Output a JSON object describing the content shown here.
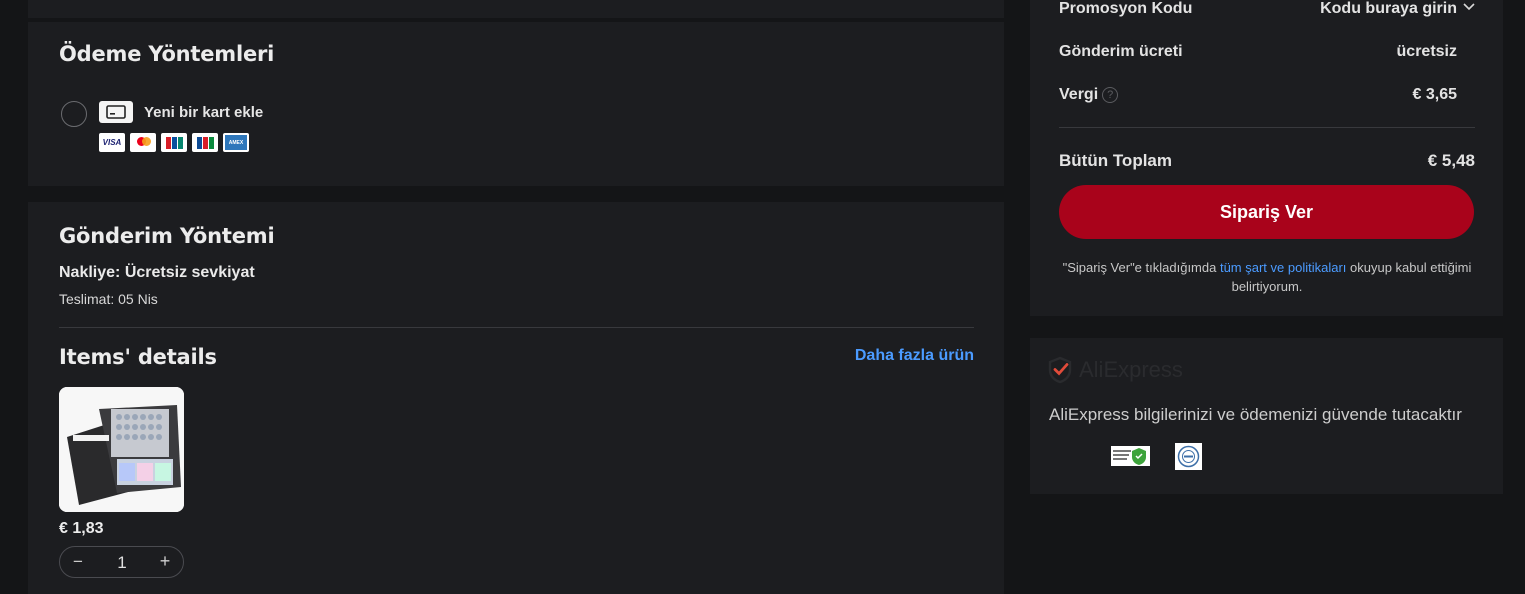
{
  "payment": {
    "title": "Ödeme Yöntemleri",
    "add_card_label": "Yeni bir kart ekle",
    "card_brands": [
      "visa",
      "mastercard",
      "unionpay",
      "jcb",
      "amex"
    ],
    "visa_text": "VISA"
  },
  "shipping": {
    "title": "Gönderim Yöntemi",
    "method": "Nakliye: Ücretsiz sevkiyat",
    "delivery": "Teslimat: 05 Nis",
    "items_title": "Items' details",
    "more_items": "Daha fazla ürün",
    "item": {
      "price": "€ 1,83",
      "quantity": "1",
      "minus": "−",
      "plus": "+"
    }
  },
  "summary": {
    "promo_label": "Promosyon Kodu",
    "promo_value": "Kodu buraya girin",
    "shipping_label": "Gönderim ücreti",
    "shipping_value": "ücretsiz",
    "tax_label": "Vergi",
    "tax_value": "€ 3,65",
    "total_label": "Bütün Toplam",
    "total_value": "€ 5,48",
    "order_button": "Sipariş Ver",
    "terms_before": "\"Sipariş Ver\"e tıkladığımda ",
    "terms_link": "tüm şart ve politikaları",
    "terms_after": " okuyup kabul ettiğimi belirtiyorum."
  },
  "security": {
    "brand": "AliExpress",
    "text": "AliExpress bilgilerinizi ve ödemenizi güvende tutacaktır"
  },
  "colors": {
    "accent_red": "#a9031b",
    "link_blue": "#4b9bff",
    "card_bg": "#1c1d20",
    "page_bg": "#141517"
  }
}
